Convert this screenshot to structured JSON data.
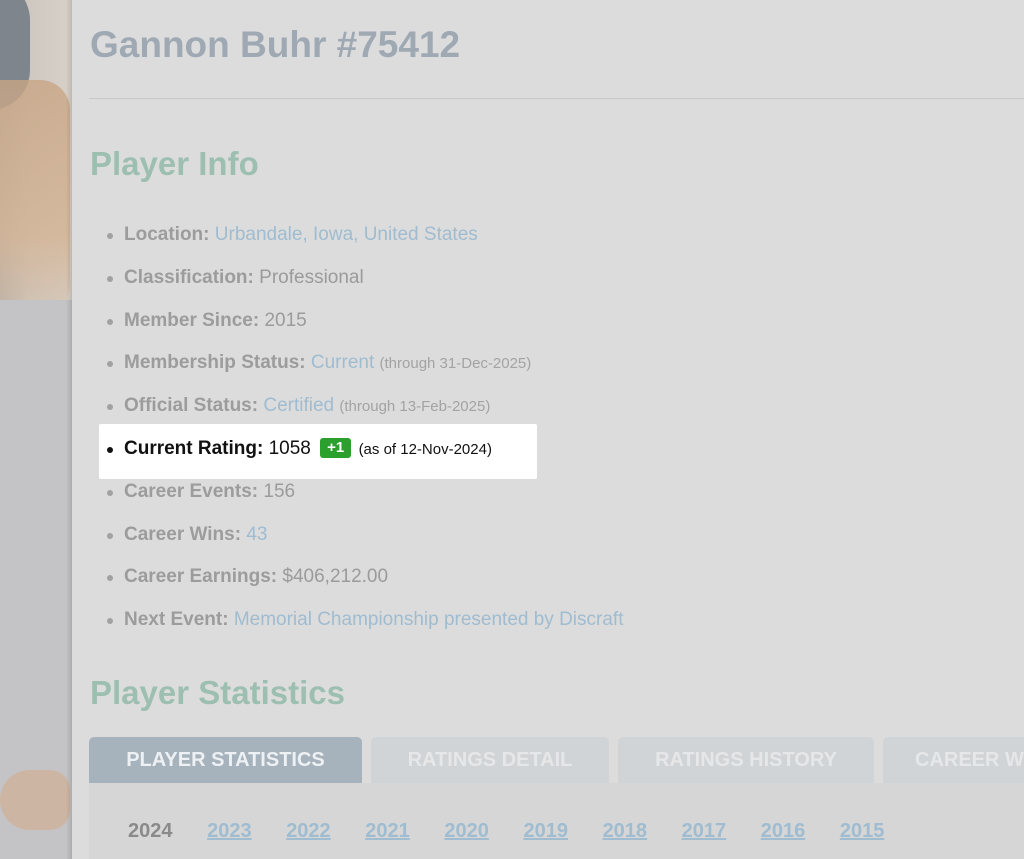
{
  "header": {
    "player_name": "Gannon Buhr #75412"
  },
  "player_info": {
    "title": "Player Info",
    "location": {
      "label": "Location:",
      "value": "Urbandale, Iowa, United States"
    },
    "classification": {
      "label": "Classification:",
      "value": "Professional"
    },
    "member_since": {
      "label": "Member Since:",
      "value": "2015"
    },
    "membership_status": {
      "label": "Membership Status:",
      "value": "Current",
      "note": "(through 31-Dec-2025)"
    },
    "official_status": {
      "label": "Official Status:",
      "value": "Certified",
      "note": "(through 13-Feb-2025)"
    },
    "current_rating": {
      "label": "Current Rating:",
      "value": "1058",
      "change": "+1",
      "note": "(as of 12-Nov-2024)",
      "change_color": "#2ca02c"
    },
    "career_events": {
      "label": "Career Events:",
      "value": "156"
    },
    "career_wins": {
      "label": "Career Wins:",
      "value": "43"
    },
    "career_earnings": {
      "label": "Career Earnings:",
      "value": "$406,212.00"
    },
    "next_event": {
      "label": "Next Event:",
      "value": "Memorial Championship presented by Discraft"
    }
  },
  "player_statistics": {
    "title": "Player Statistics",
    "tabs": [
      {
        "label": "PLAYER STATISTICS",
        "active": true
      },
      {
        "label": "RATINGS DETAIL",
        "active": false
      },
      {
        "label": "RATINGS HISTORY",
        "active": false
      },
      {
        "label": "CAREER W",
        "active": false
      }
    ],
    "years": [
      "2024",
      "2023",
      "2022",
      "2021",
      "2020",
      "2019",
      "2018",
      "2017",
      "2016",
      "2015"
    ],
    "selected_year": "2024"
  },
  "colors": {
    "heading_gray": "#9fa9b3",
    "section_green": "#9dbfb1",
    "link_blue": "#9fbcd0",
    "overlay": "#dcdcdc",
    "highlight": "#ffffff"
  }
}
